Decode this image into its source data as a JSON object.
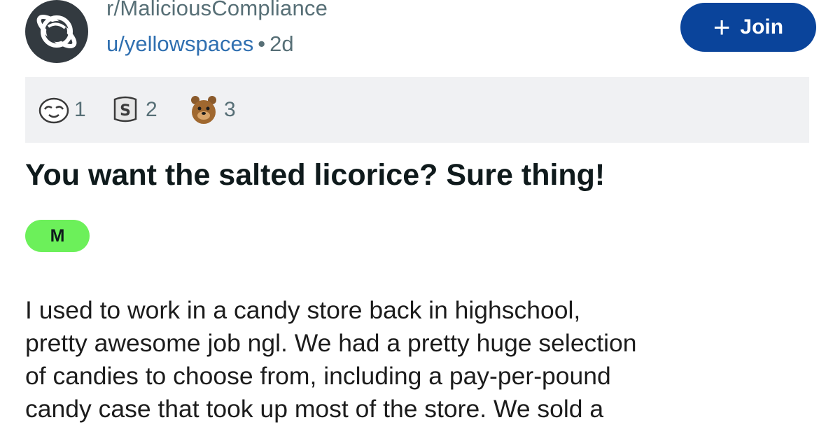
{
  "header": {
    "subreddit": "r/MaliciousCompliance",
    "username": "u/yellowspaces",
    "separator": "•",
    "age": "2d",
    "join_plus": "+",
    "join_label": "Join",
    "avatar_icon": "planet-icon"
  },
  "awards": [
    {
      "icon": "wholesome-award-icon",
      "count": "1"
    },
    {
      "icon": "silver-award-icon",
      "count": "2"
    },
    {
      "icon": "bear-award-icon",
      "count": "3"
    }
  ],
  "post": {
    "title": "You want the salted licorice? Sure thing!",
    "flair": "M",
    "body_lines": [
      "I used to work in a candy store back in highschool,",
      "pretty awesome job ngl. We had a pretty huge selection",
      "of candies to choose from, including a pay-per-pound",
      "candy case that took up most of the store. We sold a"
    ]
  },
  "colors": {
    "join_button": "#0a449b",
    "flair_bg": "#6cf05a",
    "username": "#2f6fb0",
    "awards_bg": "#f0f1f3",
    "avatar_bg": "#333a40"
  }
}
